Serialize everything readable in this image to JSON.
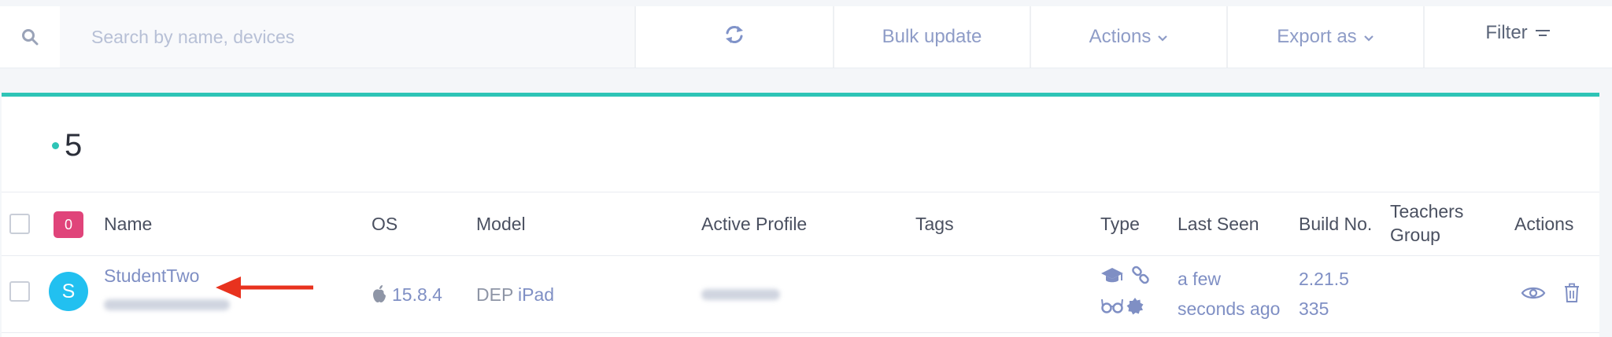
{
  "toolbar": {
    "search": {
      "placeholder": "Search by name, devices",
      "value": "",
      "icon": "search-icon"
    },
    "refresh_icon": "refresh-icon",
    "bulk_update_label": "Bulk update",
    "actions_label": "Actions",
    "export_label": "Export as",
    "filter_label": "Filter"
  },
  "summary": {
    "count": "5"
  },
  "table": {
    "selected_count": "0",
    "columns": {
      "name": "Name",
      "os": "OS",
      "model": "Model",
      "active_profile": "Active Profile",
      "tags": "Tags",
      "type": "Type",
      "last_seen": "Last Seen",
      "build_no": "Build No.",
      "teachers_group_line1": "Teachers",
      "teachers_group_line2": "Group",
      "actions": "Actions"
    },
    "rows": [
      {
        "avatar_initial": "S",
        "name": "StudentTwo",
        "os_icon": "apple-icon",
        "os_version": "15.8.4",
        "model_prefix": "DEP",
        "model_name": "iPad",
        "type_icons": [
          "graduation-cap-icon",
          "link-icon",
          "glasses-icon",
          "badge-icon"
        ],
        "last_seen_line1": "a few",
        "last_seen_line2": "seconds ago",
        "build_line1": "2.21.5",
        "build_line2": "335",
        "actions": [
          "eye-icon",
          "trash-icon"
        ]
      }
    ]
  },
  "colors": {
    "accent": "#2ec4b6",
    "link": "#7f8fc4",
    "badge": "#e0447a",
    "avatar": "#22c0f0",
    "arrow": "#e8321e"
  }
}
